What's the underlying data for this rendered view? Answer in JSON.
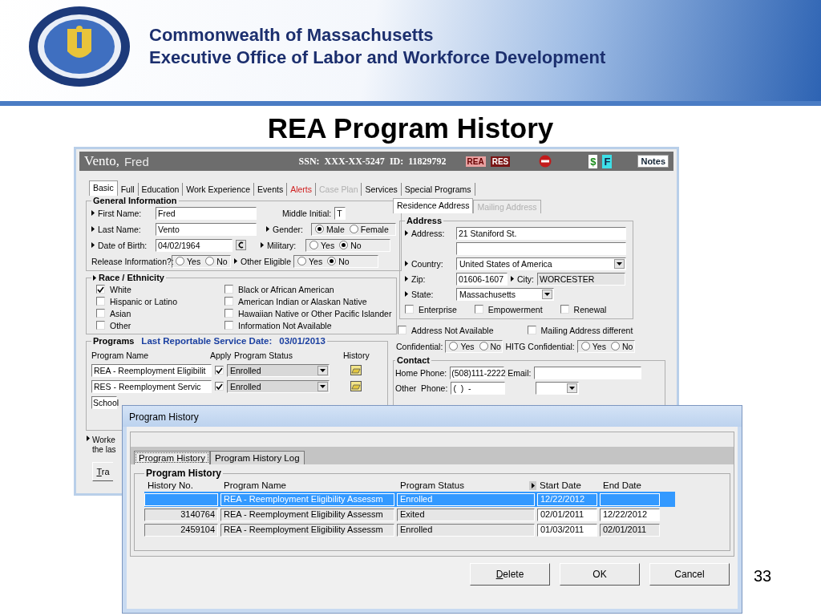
{
  "header": {
    "line_1": "Commonwealth of Massachusetts",
    "line_2": "Executive Office of Labor and Workforce Development"
  },
  "slide_title": "REA Program History",
  "client_window": {
    "name_last": "Vento,",
    "name_first": "Fred",
    "ssn_label": "SSN:",
    "ssn": "XXX-XX-5247",
    "id_label": "ID:",
    "id": "11829792",
    "flags": [
      {
        "kind": "rea",
        "label": "REA"
      },
      {
        "kind": "res",
        "label": "RES"
      },
      {
        "kind": "stop"
      },
      {
        "kind": "dollar",
        "label": "$"
      },
      {
        "kind": "f",
        "label": "F"
      }
    ],
    "notes_button": "Notes",
    "tabs": [
      {
        "label": "Basic",
        "selected": true,
        "disabled": false,
        "kind": "plain"
      },
      {
        "label": "Full",
        "selected": false,
        "disabled": false,
        "kind": "plain"
      },
      {
        "label": "Education",
        "selected": false,
        "disabled": false,
        "kind": "plain"
      },
      {
        "label": "Work Experience",
        "selected": false,
        "disabled": false,
        "kind": "plain"
      },
      {
        "label": "Events",
        "selected": false,
        "disabled": false,
        "kind": "plain"
      },
      {
        "label": "Alerts",
        "selected": false,
        "disabled": false,
        "kind": "alert"
      },
      {
        "label": "Case Plan",
        "selected": false,
        "disabled": true,
        "kind": "plain"
      },
      {
        "label": "Services",
        "selected": false,
        "disabled": false,
        "kind": "plain"
      },
      {
        "label": "Special Programs",
        "selected": false,
        "disabled": false,
        "kind": "plain"
      }
    ],
    "general_information": {
      "title": "General Information",
      "first_name": {
        "label": "First Name:",
        "value": "Fred",
        "required": true
      },
      "middle_initial": {
        "label": "Middle Initial:",
        "value": "T",
        "required": false
      },
      "last_name": {
        "label": "Last Name:",
        "value": "Vento",
        "required": true
      },
      "gender": {
        "label": "Gender:",
        "required": true,
        "options": [
          {
            "label": "Male",
            "selected": true
          },
          {
            "label": "Female",
            "selected": false
          }
        ]
      },
      "date_of_birth": {
        "label": "Date of Birth:",
        "value": "04/02/1964",
        "required": true
      },
      "military": {
        "label": "Military:",
        "required": true,
        "options": [
          {
            "label": "Yes",
            "selected": false
          },
          {
            "label": "No",
            "selected": true
          }
        ]
      },
      "release_information": {
        "label": "Release Information?:",
        "required": false,
        "options": [
          {
            "label": "Yes",
            "selected": false
          },
          {
            "label": "No",
            "selected": false
          }
        ]
      },
      "other_eligible": {
        "label": "Other Eligible",
        "required": true,
        "options": [
          {
            "label": "Yes",
            "selected": false
          },
          {
            "label": "No",
            "selected": true
          }
        ]
      }
    },
    "race_ethnicity": {
      "title": "Race / Ethnicity",
      "options": [
        {
          "label": "White",
          "checked": true
        },
        {
          "label": "Hispanic or Latino",
          "checked": false
        },
        {
          "label": "Asian",
          "checked": false
        },
        {
          "label": "Other",
          "checked": false
        },
        {
          "label": "Black or African American",
          "checked": false
        },
        {
          "label": "American Indian or Alaskan Native",
          "checked": false
        },
        {
          "label": "Hawaiian Native or Other Pacific Islander",
          "checked": false
        },
        {
          "label": "Information Not Available",
          "checked": false
        }
      ]
    },
    "programs": {
      "title": "Programs",
      "service_date_label": "Last Reportable Service Date:",
      "service_date": "03/01/2013",
      "columns": [
        "Program Name",
        "Apply",
        "Program Status",
        "History"
      ],
      "rows": [
        {
          "name": "REA - Reemployment Eligibilit",
          "apply": true,
          "status": "Enrolled"
        },
        {
          "name": "RES - Reemployment Servic",
          "apply": true,
          "status": "Enrolled"
        },
        {
          "name": "School"
        }
      ]
    },
    "worker_note": [
      "Worke",
      "the las"
    ],
    "bottom_button": "Tra",
    "address_tabs": [
      {
        "label": "Residence Address",
        "selected": true,
        "disabled": false
      },
      {
        "label": "Mailing Address",
        "selected": false,
        "disabled": true
      }
    ],
    "address": {
      "title": "Address",
      "street": {
        "label": "Address:",
        "value": "21 Staniford St."
      },
      "country": {
        "label": "Country:",
        "value": "United States of America"
      },
      "zip": {
        "label": "Zip:",
        "value": "01606-1607"
      },
      "city": {
        "label": "City:",
        "value": "WORCESTER"
      },
      "state": {
        "label": "State:",
        "value": "Massachusetts"
      },
      "zones": [
        {
          "label": "Enterprise",
          "checked": false
        },
        {
          "label": "Empowerment",
          "checked": false
        },
        {
          "label": "Renewal",
          "checked": false
        }
      ]
    },
    "address_checks": [
      {
        "label": "Address Not Available",
        "checked": false
      },
      {
        "label": "Mailing Address different",
        "checked": false
      }
    ],
    "confidential": {
      "label": "Confidential:",
      "options": [
        {
          "label": "Yes",
          "selected": false
        },
        {
          "label": "No",
          "selected": false
        }
      ]
    },
    "hitg_confidential": {
      "label": "HITG Confidential:",
      "options": [
        {
          "label": "Yes",
          "selected": false
        },
        {
          "label": "No",
          "selected": false
        }
      ]
    },
    "contact": {
      "title": "Contact",
      "home_phone": {
        "label": "Home Phone:",
        "value": "(508)111-2222"
      },
      "email": {
        "label": "Email:"
      },
      "other_phone": {
        "label": "Other  Phone:",
        "value": "(  )  -"
      }
    }
  },
  "history_dialog": {
    "title": "Program History",
    "tabs": [
      {
        "label": "Program History",
        "selected": true
      },
      {
        "label": "Program History Log",
        "selected": false
      }
    ],
    "group_title": "Program History",
    "columns": [
      "History No.",
      "Program Name",
      "Program Status",
      "Start Date",
      "End Date"
    ],
    "rows": [
      {
        "program_name": "REA - Reemployment Eligibility Assessm",
        "status": "Enrolled",
        "start_date": "12/22/2012",
        "selected": true
      },
      {
        "history_no": "3140764",
        "program_name": "REA - Reemployment Eligibility Assessm",
        "status": "Exited",
        "start_date": "02/01/2011",
        "end_date": "12/22/2012",
        "selected": false
      },
      {
        "history_no": "2459104",
        "program_name": "REA - Reemployment Eligibility Assessm",
        "status": "Enrolled",
        "start_date": "01/03/2011",
        "end_date": "02/01/2011",
        "selected": false
      }
    ],
    "buttons": [
      {
        "label": "Delete",
        "mnemonic": true
      },
      {
        "label": "OK",
        "mnemonic": false
      },
      {
        "label": "Cancel",
        "mnemonic": false
      }
    ]
  },
  "page_number": "33"
}
